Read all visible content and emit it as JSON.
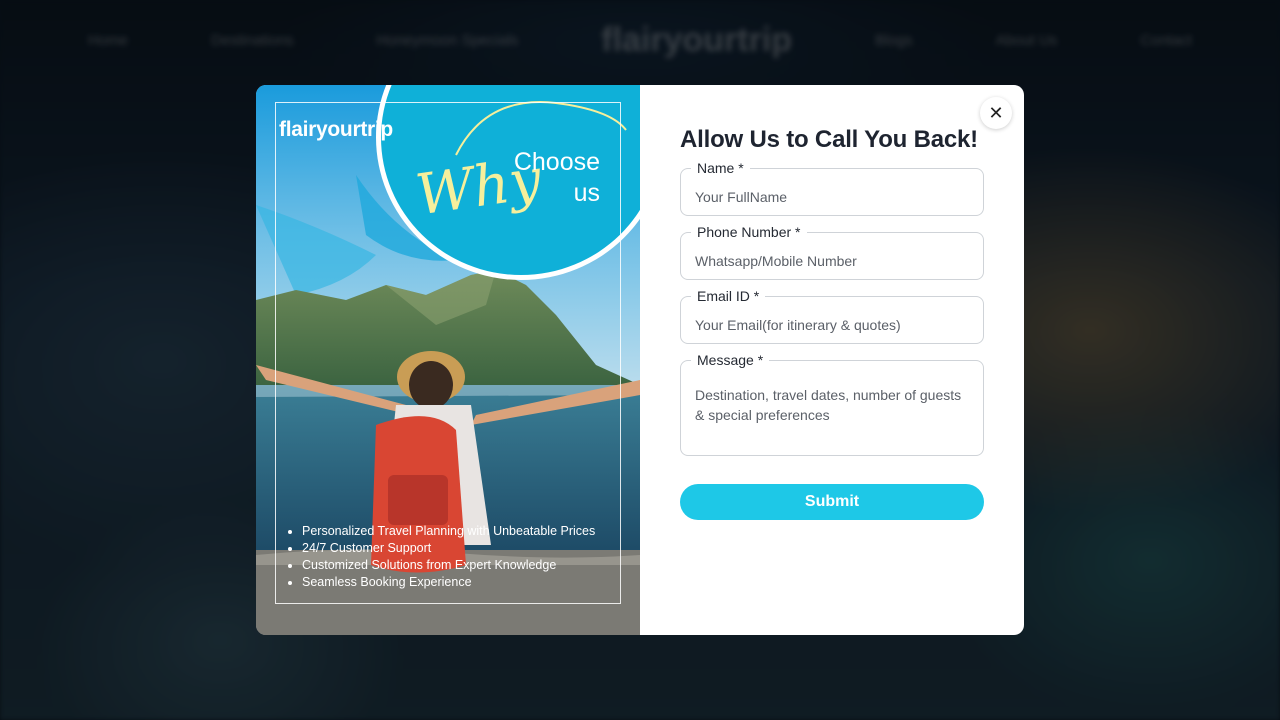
{
  "background": {
    "nav_items": [
      "Home",
      "Destinations",
      "Honeymoon Specials",
      "Blogs",
      "About Us",
      "Contact"
    ],
    "logo": "flairyourtrip"
  },
  "promo": {
    "brand": "flairyourtrip",
    "why": "Why",
    "choose_line1": "Choose",
    "choose_line2": "us",
    "features": [
      "Personalized Travel Planning with Unbeatable Prices",
      "24/7 Customer Support",
      "Customized Solutions from Expert Knowledge",
      "Seamless Booking Experience"
    ]
  },
  "form": {
    "title": "Allow Us to Call You Back!",
    "close_icon": "close-icon",
    "fields": {
      "name": {
        "label": "Name *",
        "placeholder": "Your FullName",
        "value": ""
      },
      "phone": {
        "label": "Phone Number *",
        "placeholder": "Whatsapp/Mobile Number",
        "value": ""
      },
      "email": {
        "label": "Email ID *",
        "placeholder": "Your Email(for itinerary & quotes)",
        "value": ""
      },
      "message": {
        "label": "Message *",
        "placeholder": "Destination, travel dates, number of guests & special preferences",
        "value": ""
      }
    },
    "submit_label": "Submit"
  },
  "colors": {
    "accent": "#1ec8e7",
    "why_circle": "#0fb0d8",
    "why_text": "#f6ef9c",
    "title": "#1e2430"
  }
}
